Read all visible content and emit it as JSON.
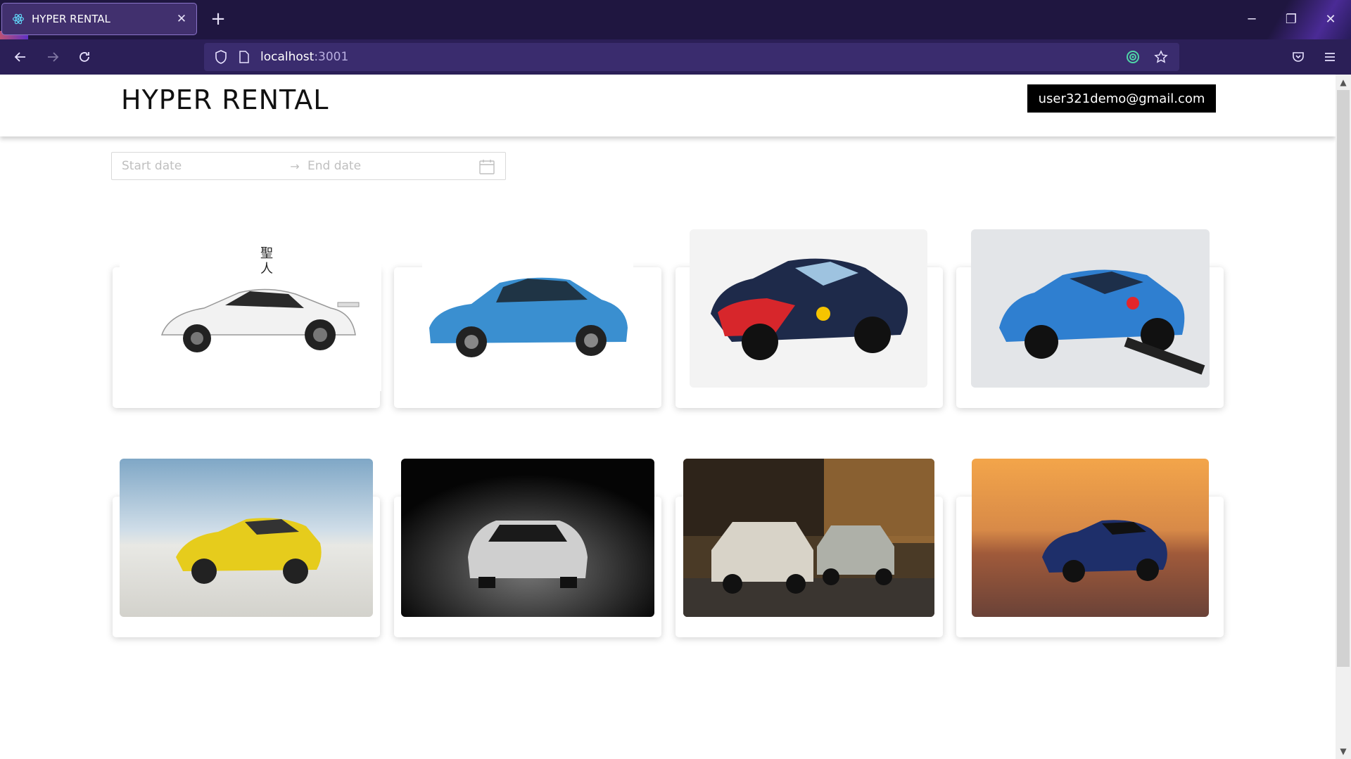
{
  "browser": {
    "tab_title": "HYPER RENTAL",
    "url_host": "localhost",
    "url_port": ":3001"
  },
  "header": {
    "brand": "HYPER RENTAL",
    "user_email": "user321demo@gmail.com"
  },
  "date_range": {
    "start_placeholder": "Start date",
    "end_placeholder": "End date"
  },
  "cars": [
    {
      "image": "white-nissan-skyline-gtr",
      "body_color": "#f2f2f2",
      "background": "#ffffff"
    },
    {
      "image": "blue-honda-civic",
      "body_color": "#3a8fd0",
      "background": "#ffffff"
    },
    {
      "image": "hyundai-i20-rally-car",
      "body_color": "#1e2a4a",
      "background": "#f3f3f3"
    },
    {
      "image": "vw-polo-wrc-redbull",
      "body_color": "#2f7fd0",
      "background": "#e3e5e8"
    },
    {
      "image": "yellow-mercedes-amg-gt",
      "body_color": "#e6cc1c",
      "background": "#c9d7e2"
    },
    {
      "image": "silver-tesla-model-s-dark",
      "body_color": "#cfcfcf",
      "background": "#050505"
    },
    {
      "image": "vintage-sedans-street-evening",
      "body_color": "#d8d3c8",
      "background": "#4a3a26"
    },
    {
      "image": "blue-dodge-challenger-sunset",
      "body_color": "#1e2f6a",
      "background": "#c97a3e"
    }
  ]
}
